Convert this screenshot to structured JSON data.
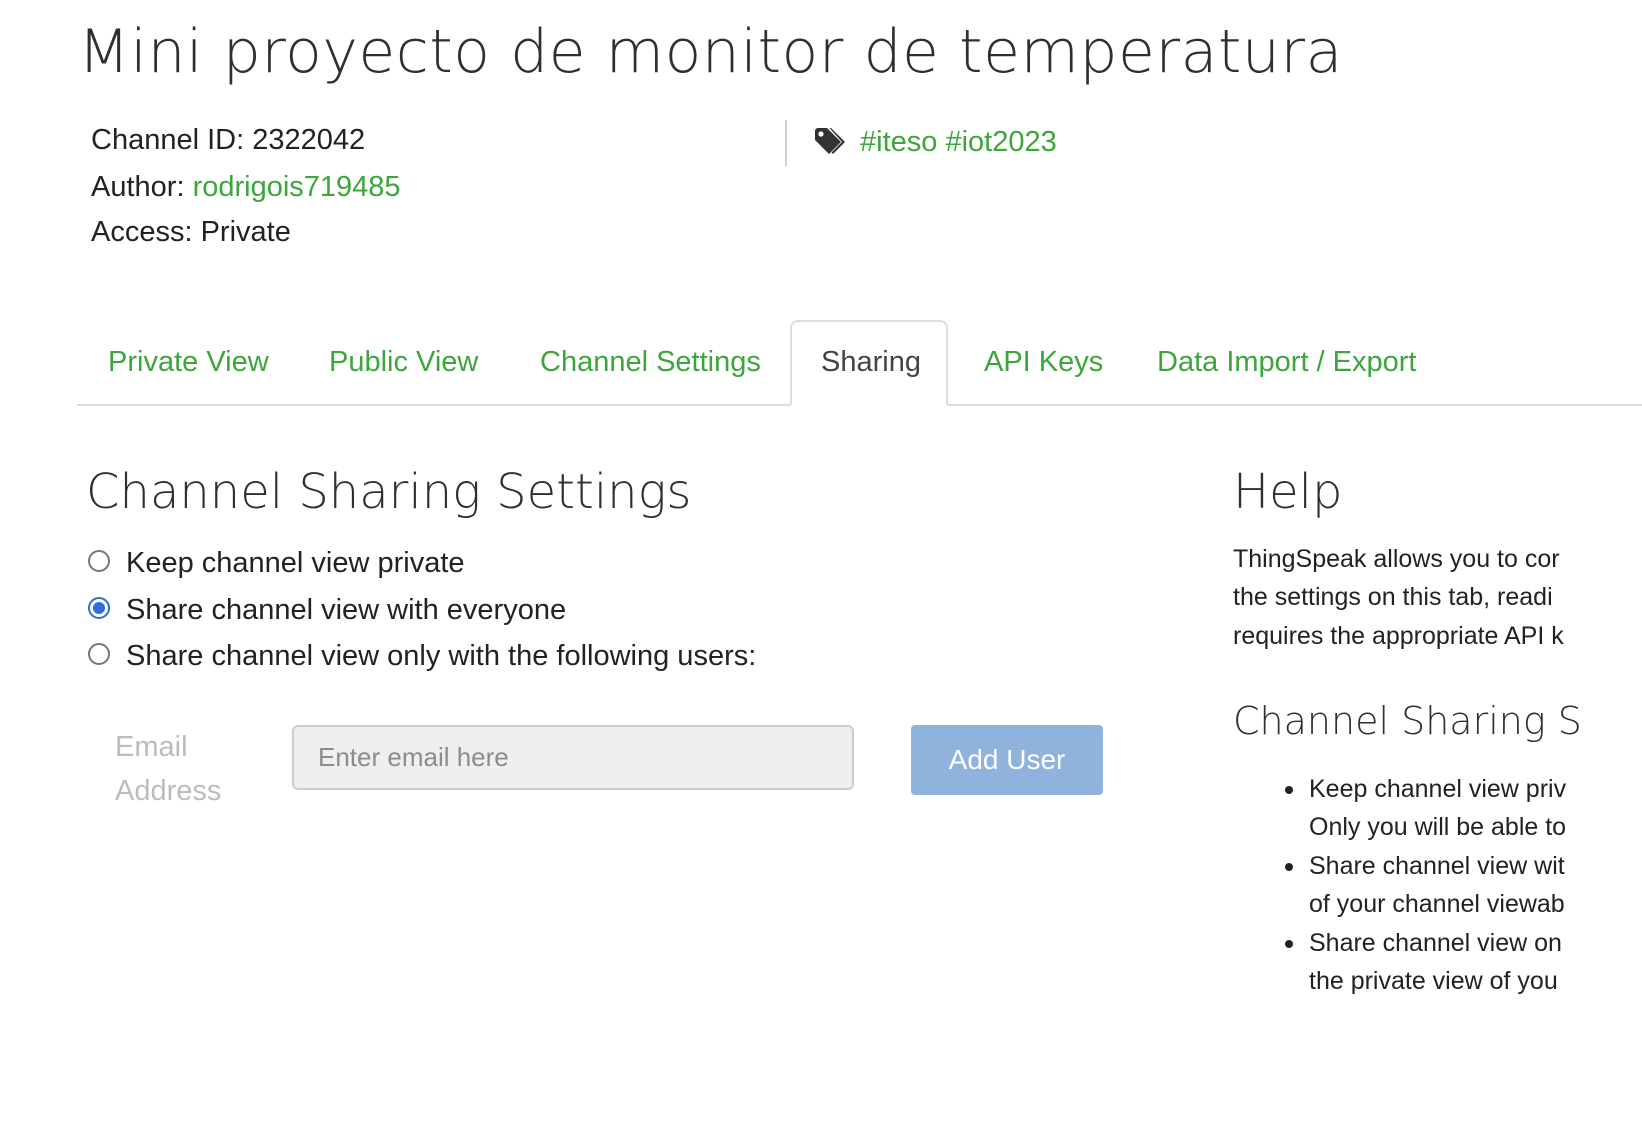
{
  "header": {
    "title": "Mini proyecto de monitor de temperatura"
  },
  "meta": {
    "channel_id_label": "Channel ID:",
    "channel_id_value": "2322042",
    "author_label": "Author:",
    "author_value": "rodrigois719485",
    "access_label": "Access:",
    "access_value": "Private",
    "tags_icon": "tags-icon",
    "tags": "#iteso #iot2023"
  },
  "tabs": [
    {
      "label": "Private View"
    },
    {
      "label": "Public View"
    },
    {
      "label": "Channel Settings"
    },
    {
      "label": "Sharing",
      "active": true
    },
    {
      "label": "API Keys"
    },
    {
      "label": "Data Import / Export"
    }
  ],
  "sharing": {
    "heading": "Channel Sharing Settings",
    "options": [
      {
        "label": "Keep channel view private",
        "checked": false
      },
      {
        "label": "Share channel view with everyone",
        "checked": true
      },
      {
        "label": "Share channel view only with the following users:",
        "checked": false
      }
    ],
    "email_label": "Email Address",
    "email_placeholder": "Enter email here",
    "email_value": "",
    "add_user_label": "Add User"
  },
  "help": {
    "heading": "Help",
    "intro_lines": [
      "ThingSpeak allows you to cor",
      "the settings on this tab, readi",
      "requires the appropriate API k"
    ],
    "subheading": "Channel Sharing S",
    "bullets": [
      {
        "lines": [
          "Keep channel view priv",
          "Only you will be able to"
        ]
      },
      {
        "lines": [
          "Share channel view wit",
          "of your channel viewab"
        ]
      },
      {
        "lines": [
          "Share channel view on",
          "the private view of you"
        ]
      }
    ]
  },
  "colors": {
    "link_green": "#3ca63c",
    "radio_blue": "#2b6fdc",
    "button_blue": "#8fb3dc"
  }
}
